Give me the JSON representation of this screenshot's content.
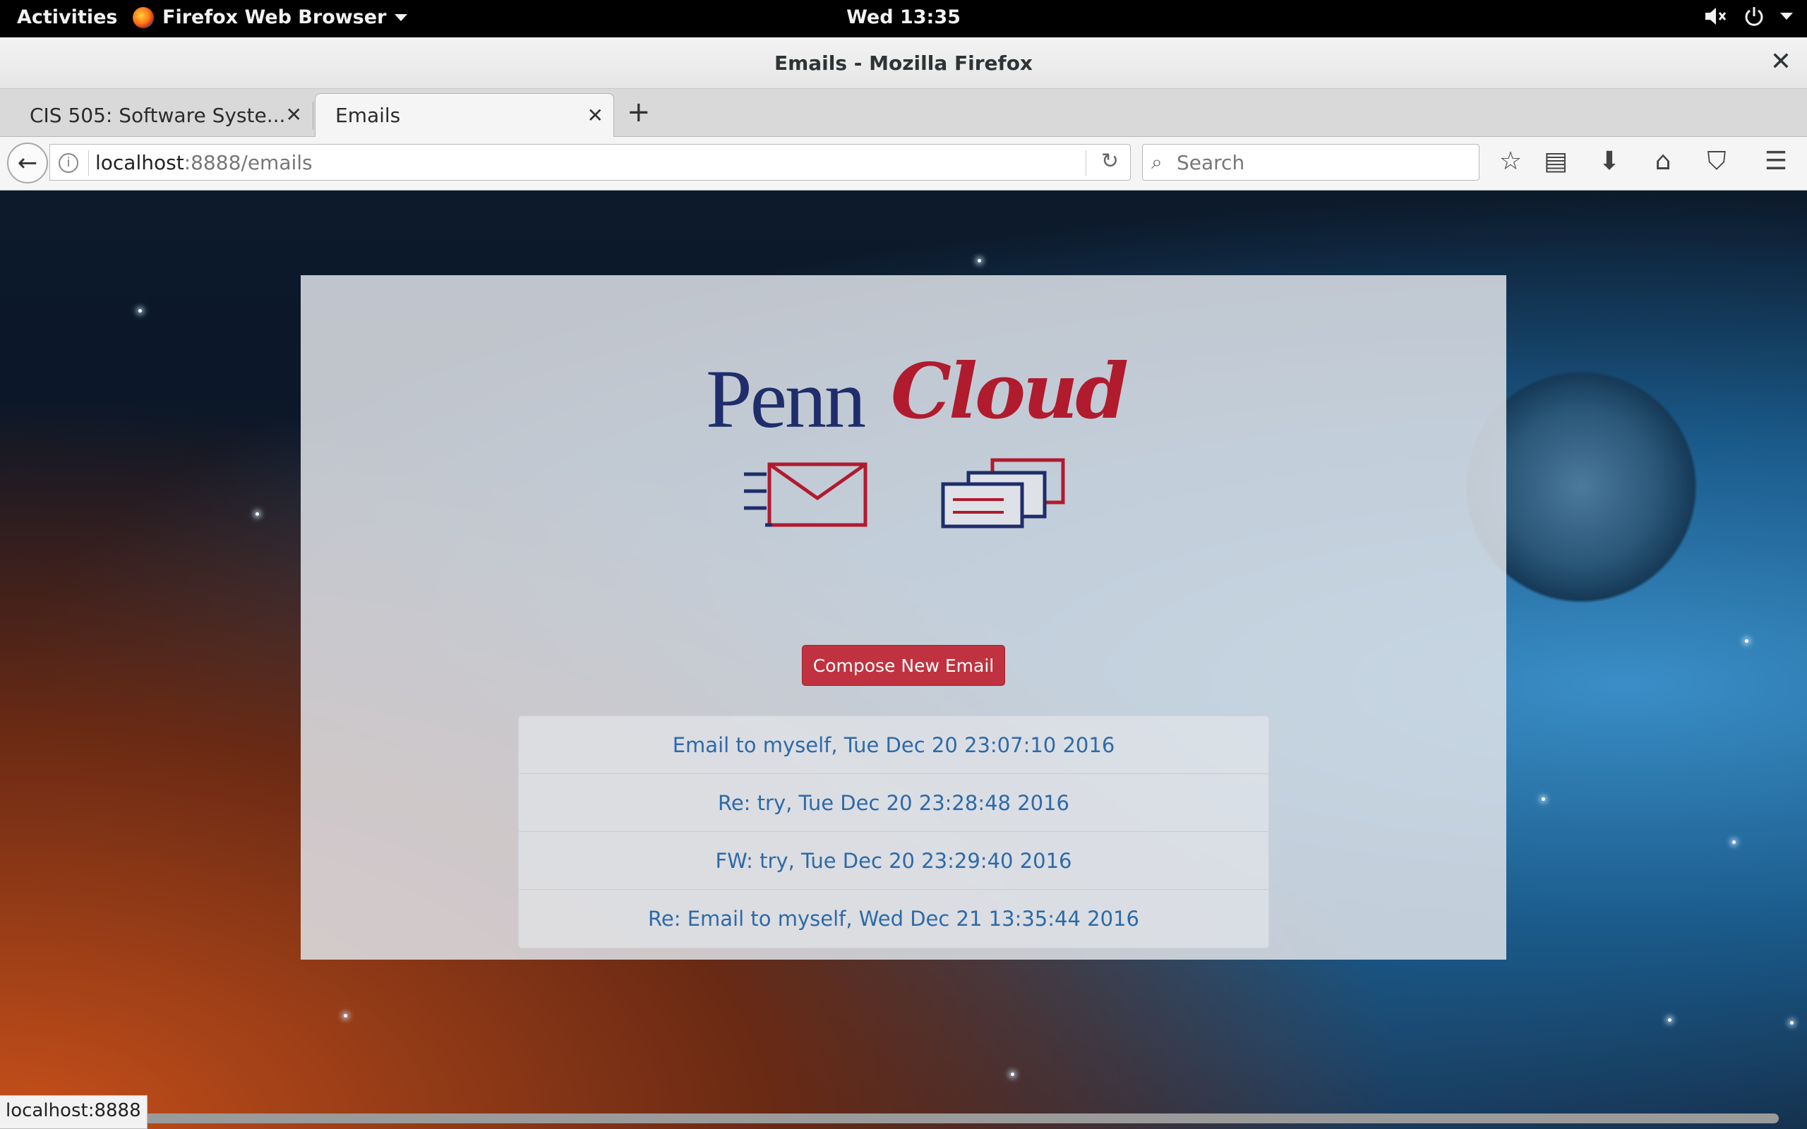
{
  "topbar": {
    "activities": "Activities",
    "app_name": "Firefox Web Browser",
    "clock": "Wed 13:35",
    "volume_icon": "volume-muted-icon",
    "power_icon": "power-icon"
  },
  "window": {
    "title": "Emails - Mozilla Firefox"
  },
  "tabs": [
    {
      "label": "CIS 505: Software Syste..."
    },
    {
      "label": "Emails"
    }
  ],
  "navbar": {
    "url_host": "localhost",
    "url_rest": ":8888/emails",
    "search_placeholder": "Search"
  },
  "page": {
    "logo_penn": "Penn",
    "logo_cloud": "Cloud",
    "compose_label": "Compose New Email",
    "emails": [
      "Email to myself, Tue Dec 20 23:07:10 2016",
      "Re: try, Tue Dec 20 23:28:48 2016",
      "FW: try, Tue Dec 20 23:29:40 2016",
      "Re: Email to myself, Wed Dec 21 13:35:44 2016"
    ],
    "colors": {
      "brand_blue": "#1f2d6b",
      "brand_red": "#b01b2e",
      "compose_bg": "#c0323f",
      "link": "#2d6aa8"
    }
  },
  "statusbar": {
    "text": "localhost:8888"
  }
}
